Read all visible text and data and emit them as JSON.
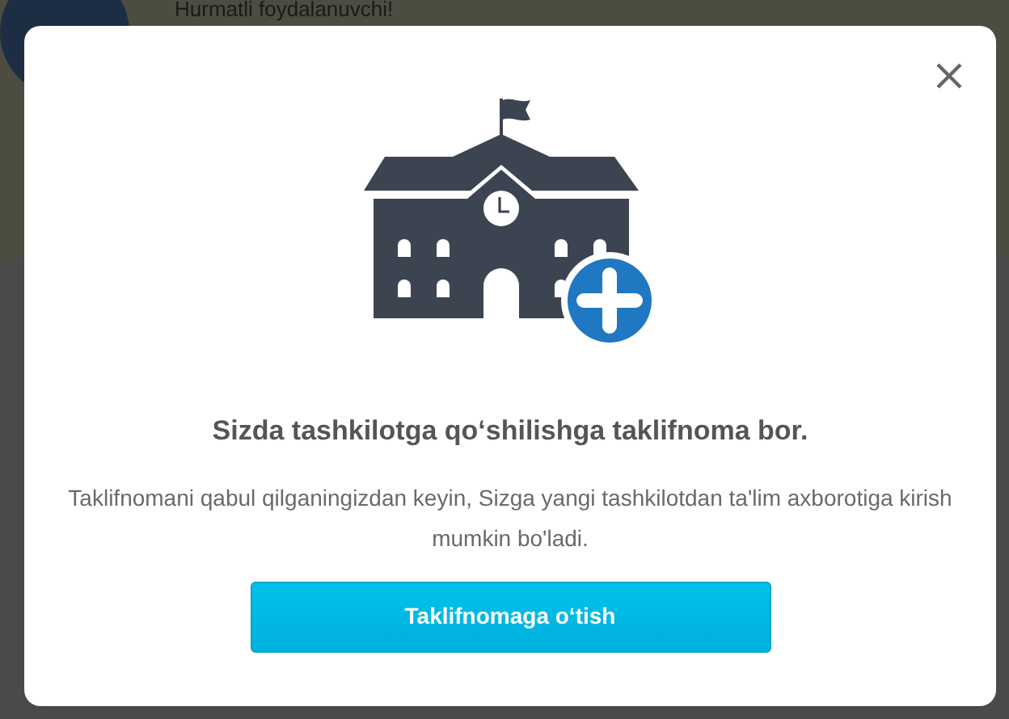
{
  "background": {
    "greeting": "Hurmatli foydalanuvchi!"
  },
  "dialog": {
    "title": "Sizda tashkilotga qo‘shilishga taklifnoma bor.",
    "message": "Taklifnomani qabul qilganingizdan keyin, Sizga yangi tashkilotdan ta'lim axborotiga kirish mumkin bo'ladi.",
    "button": "Taklifnomaga o‘tish"
  }
}
